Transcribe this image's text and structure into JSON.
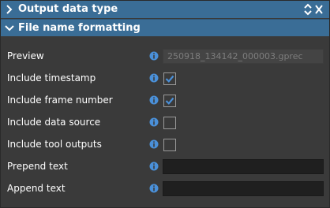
{
  "sections": [
    {
      "title": "Output data type",
      "expanded": false
    },
    {
      "title": "File name formatting",
      "expanded": true
    }
  ],
  "rows": [
    {
      "label": "Preview",
      "type": "readonly",
      "value": "250918_134142_000003.gprec"
    },
    {
      "label": "Include timestamp",
      "type": "checkbox",
      "checked": true
    },
    {
      "label": "Include frame number",
      "type": "checkbox",
      "checked": true
    },
    {
      "label": "Include data source",
      "type": "checkbox",
      "checked": false
    },
    {
      "label": "Include tool outputs",
      "type": "checkbox",
      "checked": false
    },
    {
      "label": "Prepend text",
      "type": "text",
      "value": ""
    },
    {
      "label": "Append text",
      "type": "text",
      "value": ""
    }
  ],
  "colors": {
    "header_bg": "#3a6d96",
    "panel_bg": "#3a3a3a",
    "info_icon": "#4a90d9",
    "check_mark": "#4a90d9"
  },
  "icons": {
    "info": "info-icon",
    "collapsed": "chevron-right-icon",
    "expanded": "chevron-down-icon",
    "expand_collapse": "expand-collapse-icon"
  }
}
